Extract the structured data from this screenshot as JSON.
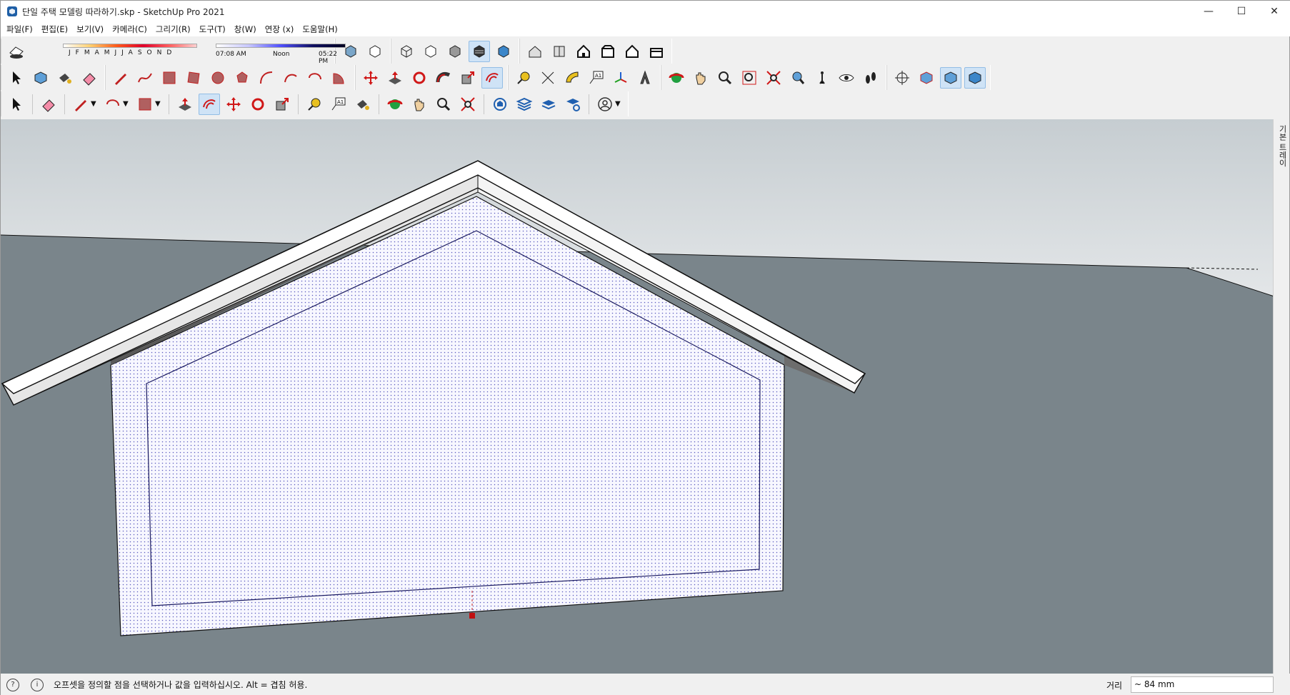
{
  "window": {
    "title": "단일 주택 모델링 따라하기.skp - SketchUp Pro 2021",
    "minimize_glyph": "—",
    "maximize_glyph": "☐",
    "close_glyph": "✕"
  },
  "menu": [
    {
      "label": "파일(F)"
    },
    {
      "label": "편집(E)"
    },
    {
      "label": "보기(V)"
    },
    {
      "label": "카메라(C)"
    },
    {
      "label": "그리기(R)"
    },
    {
      "label": "도구(T)"
    },
    {
      "label": "창(W)"
    },
    {
      "label": "연장 (x)"
    },
    {
      "label": "도움말(H)"
    }
  ],
  "shadows": {
    "months": "JFMAMJJASOND",
    "time_start": "07:08 AM",
    "time_noon": "Noon",
    "time_end": "05:22 PM"
  },
  "tray": {
    "label": "기본 트레이"
  },
  "status": {
    "message": "오프셋을 정의할 점을 선택하거나 값을 입력하십시오. Alt = 겹침 허용.",
    "measurement_label": "거리",
    "measurement_value": "~ 84 mm"
  },
  "colors": {
    "sky": "#dfe3e6",
    "ground": "#7a858b",
    "face": "#f7f7ff",
    "roof_top": "#ffffff",
    "roof_under": "#6d6d6d",
    "active_tool": "#cfe3f6"
  }
}
